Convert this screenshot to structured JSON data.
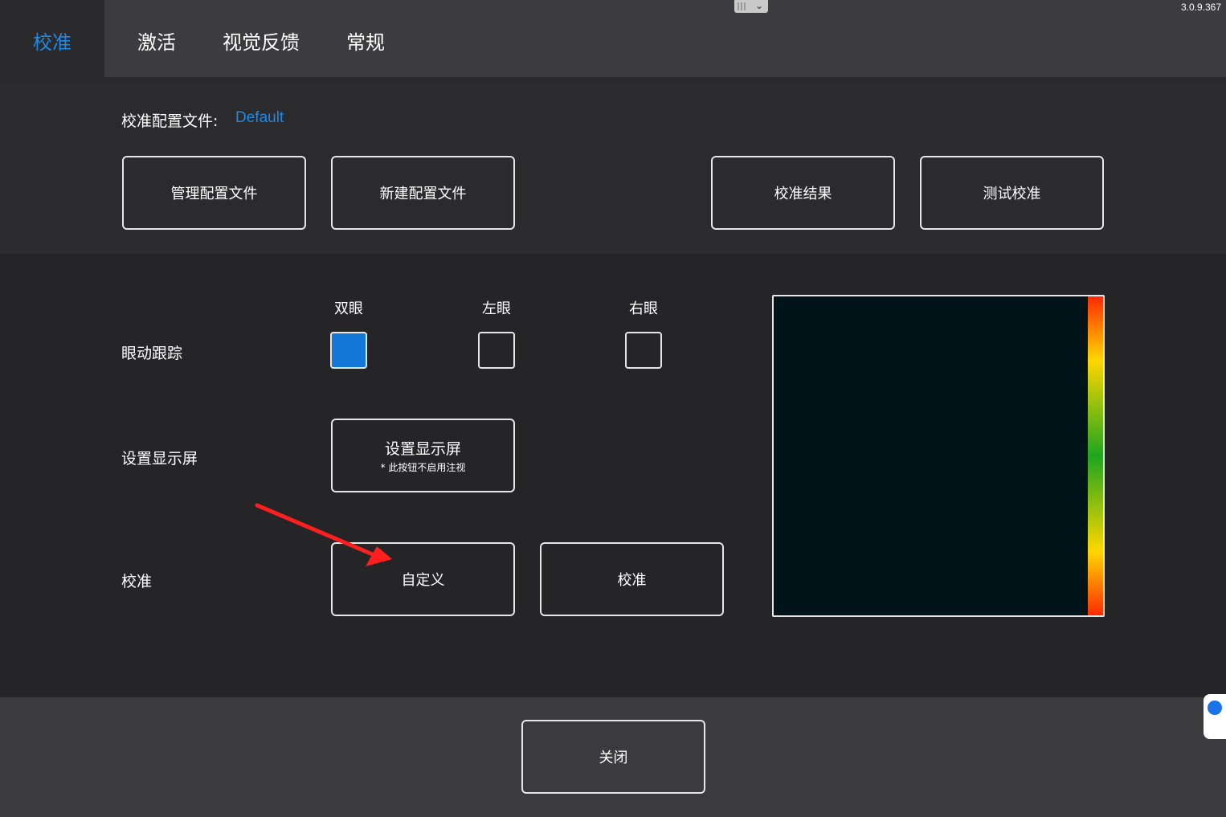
{
  "tabs": [
    {
      "label": "校准",
      "active": true
    },
    {
      "label": "激活",
      "active": false
    },
    {
      "label": "视觉反馈",
      "active": false
    },
    {
      "label": "常规",
      "active": false
    }
  ],
  "version": "3.0.9.367",
  "profile": {
    "label": "校准配置文件:",
    "value": "Default"
  },
  "top_buttons": {
    "manage": "管理配置文件",
    "new": "新建配置文件",
    "results": "校准结果",
    "test": "测试校准"
  },
  "tracking": {
    "label": "眼动跟踪",
    "options": [
      {
        "label": "双眼",
        "checked": true
      },
      {
        "label": "左眼",
        "checked": false
      },
      {
        "label": "右眼",
        "checked": false
      }
    ]
  },
  "display": {
    "label": "设置显示屏",
    "button_label": "设置显示屏",
    "button_note": "* 此按钮不启用注视"
  },
  "calibration": {
    "label": "校准",
    "custom_button": "自定义",
    "calibrate_button": "校准"
  },
  "close_button": "关闭",
  "colors": {
    "accent": "#1e8ae6",
    "checkbox_on": "#1478d8",
    "annotation_arrow": "#ff1f1f"
  }
}
